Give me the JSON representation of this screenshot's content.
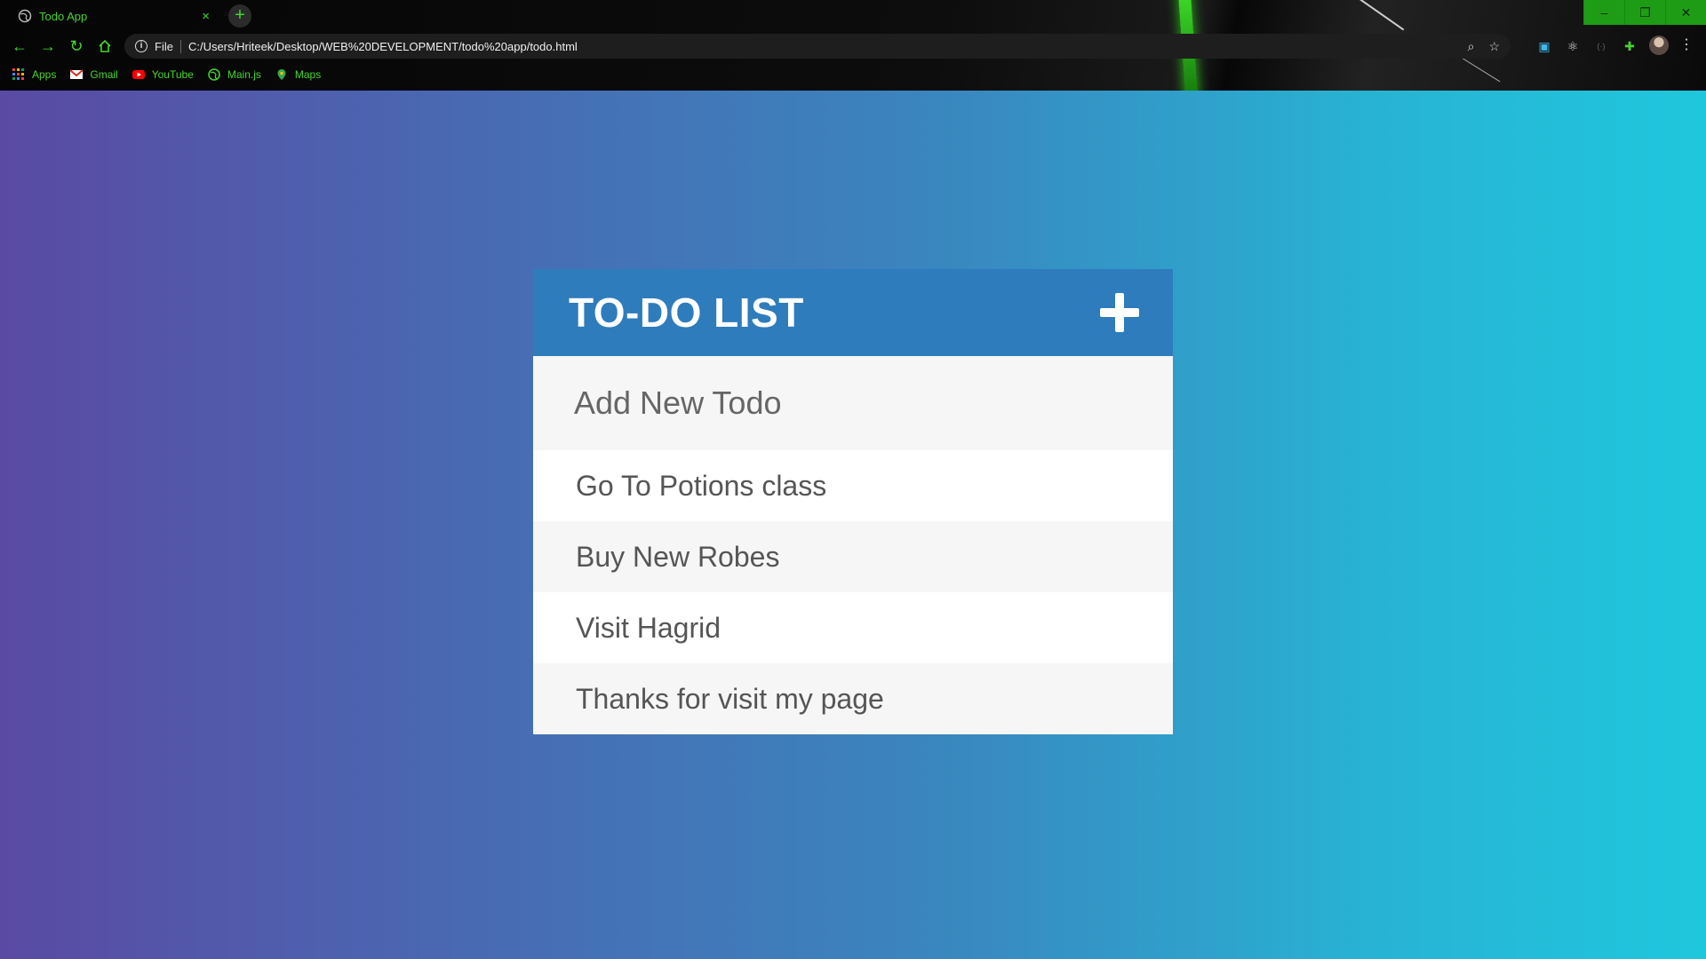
{
  "browser": {
    "tab_title": "Todo App",
    "tab_close": "×",
    "new_tab": "+",
    "scheme": "File",
    "url": "C:/Users/Hriteek/Desktop/WEB%20DEVELOPMENT/todo%20app/todo.html",
    "window_controls": {
      "minimize": "–",
      "restore": "❐",
      "close": "✕"
    },
    "bookmarks": [
      {
        "label": "Apps",
        "icon": "apps-grid-icon"
      },
      {
        "label": "Gmail",
        "icon": "gmail-icon"
      },
      {
        "label": "YouTube",
        "icon": "youtube-icon"
      },
      {
        "label": "Main.js",
        "icon": "globe-icon"
      },
      {
        "label": "Maps",
        "icon": "maps-pin-icon"
      }
    ],
    "accent_color": "#45d62c"
  },
  "todo": {
    "title": "TO-DO LIST",
    "input_placeholder": "Add New Todo",
    "items": [
      "Go To Potions class",
      "Buy New Robes",
      "Visit Hagrid",
      "Thanks for visit my page"
    ],
    "header_color": "#2e7cbc"
  }
}
